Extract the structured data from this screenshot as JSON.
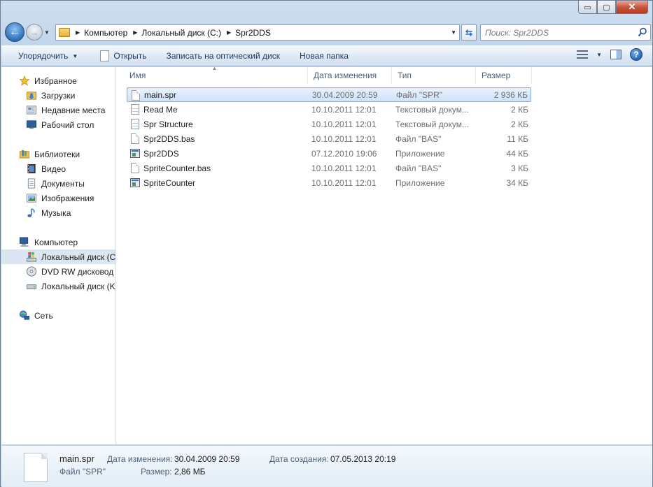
{
  "window": {
    "caption_buttons": {
      "minimize": "▭",
      "maximize": "▢",
      "close": "✕"
    }
  },
  "navbar": {
    "breadcrumbs": [
      "Компьютер",
      "Локальный диск (C:)",
      "Spr2DDS"
    ],
    "search_placeholder": "Поиск: Spr2DDS"
  },
  "toolbar": {
    "organize": "Упорядочить",
    "open": "Открыть",
    "burn": "Записать на оптический диск",
    "new_folder": "Новая папка"
  },
  "sidebar": {
    "favorites": {
      "label": "Избранное",
      "items": [
        "Загрузки",
        "Недавние места",
        "Рабочий стол"
      ]
    },
    "libraries": {
      "label": "Библиотеки",
      "items": [
        "Видео",
        "Документы",
        "Изображения",
        "Музыка"
      ]
    },
    "computer": {
      "label": "Компьютер",
      "items": [
        "Локальный диск (C",
        "DVD RW дисковод (",
        "Локальный диск (K"
      ]
    },
    "network": {
      "label": "Сеть"
    }
  },
  "columns": {
    "name": "Имя",
    "date": "Дата изменения",
    "type": "Тип",
    "size": "Размер"
  },
  "files": [
    {
      "name": "main.spr",
      "date": "30.04.2009 20:59",
      "type": "Файл \"SPR\"",
      "size": "2 936 КБ",
      "icon": "file-icon",
      "selected": true
    },
    {
      "name": "Read Me",
      "date": "10.10.2011 12:01",
      "type": "Текстовый докум...",
      "size": "2 КБ",
      "icon": "text-file-icon"
    },
    {
      "name": "Spr Structure",
      "date": "10.10.2011 12:01",
      "type": "Текстовый докум...",
      "size": "2 КБ",
      "icon": "text-file-icon"
    },
    {
      "name": "Spr2DDS.bas",
      "date": "10.10.2011 12:01",
      "type": "Файл \"BAS\"",
      "size": "11 КБ",
      "icon": "file-icon"
    },
    {
      "name": "Spr2DDS",
      "date": "07.12.2010 19:06",
      "type": "Приложение",
      "size": "44 КБ",
      "icon": "application-icon"
    },
    {
      "name": "SpriteCounter.bas",
      "date": "10.10.2011 12:01",
      "type": "Файл \"BAS\"",
      "size": "3 КБ",
      "icon": "file-icon"
    },
    {
      "name": "SpriteCounter",
      "date": "10.10.2011 12:01",
      "type": "Приложение",
      "size": "34 КБ",
      "icon": "application-icon"
    }
  ],
  "details": {
    "name": "main.spr",
    "type": "Файл \"SPR\"",
    "modified_label": "Дата изменения:",
    "modified_value": "30.04.2009 20:59",
    "size_label": "Размер:",
    "size_value": "2,86 МБ",
    "created_label": "Дата создания:",
    "created_value": "07.05.2013 20:19"
  }
}
